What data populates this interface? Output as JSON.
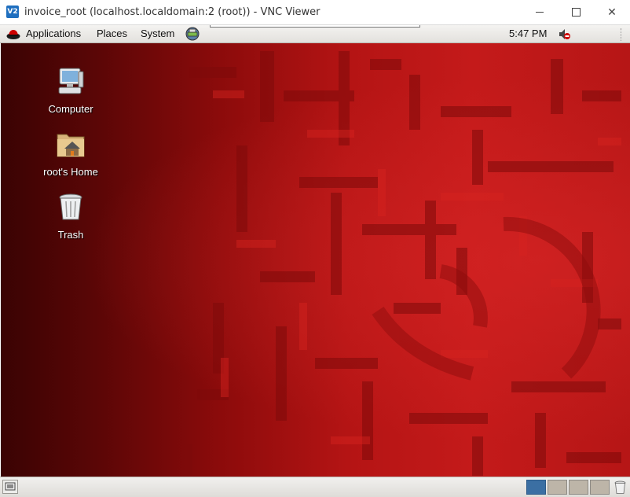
{
  "window": {
    "title": "invoice_root (localhost.localdomain:2 (root)) - VNC Viewer",
    "app_icon": "vnc-icon",
    "app_icon_text": "V2",
    "controls": [
      "minimize",
      "maximize",
      "close"
    ],
    "close_glyph": "✕"
  },
  "top_panel": {
    "menus": [
      {
        "label": "Applications"
      },
      {
        "label": "Places"
      },
      {
        "label": "System"
      }
    ],
    "clock": "5:47 PM"
  },
  "desktop": {
    "icons": [
      {
        "label": "Computer",
        "icon": "computer-icon"
      },
      {
        "label": "root's Home",
        "icon": "home-folder-icon"
      },
      {
        "label": "Trash",
        "icon": "trash-icon"
      }
    ]
  },
  "bottom_panel": {
    "workspaces": [
      {
        "active": true
      },
      {
        "active": false
      },
      {
        "active": false
      },
      {
        "active": false
      }
    ]
  },
  "colors": {
    "wallpaper_red": "#c41a1a",
    "wallpaper_dark": "#3a0303",
    "workspace_active": "#3b6fa3"
  }
}
